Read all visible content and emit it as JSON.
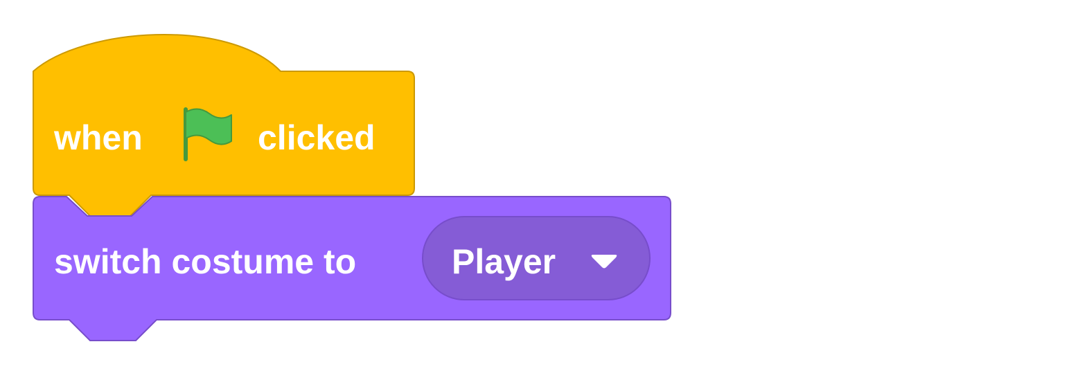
{
  "colors": {
    "events_fill": "#FFBF00",
    "events_stroke": "#CC9900",
    "looks_fill": "#9966FF",
    "looks_stroke": "#774DCB",
    "dropdown_fill": "#855CD6",
    "flag_fill": "#4CBF56",
    "flag_stroke": "#45993D",
    "text": "#FFFFFF"
  },
  "hat_block": {
    "category": "events",
    "label_when": "when",
    "icon": "green-flag-icon",
    "label_clicked": "clicked"
  },
  "command_block": {
    "category": "looks",
    "label": "switch costume to",
    "costume_menu": {
      "selected": "Player",
      "icon": "dropdown-arrow-icon"
    }
  }
}
